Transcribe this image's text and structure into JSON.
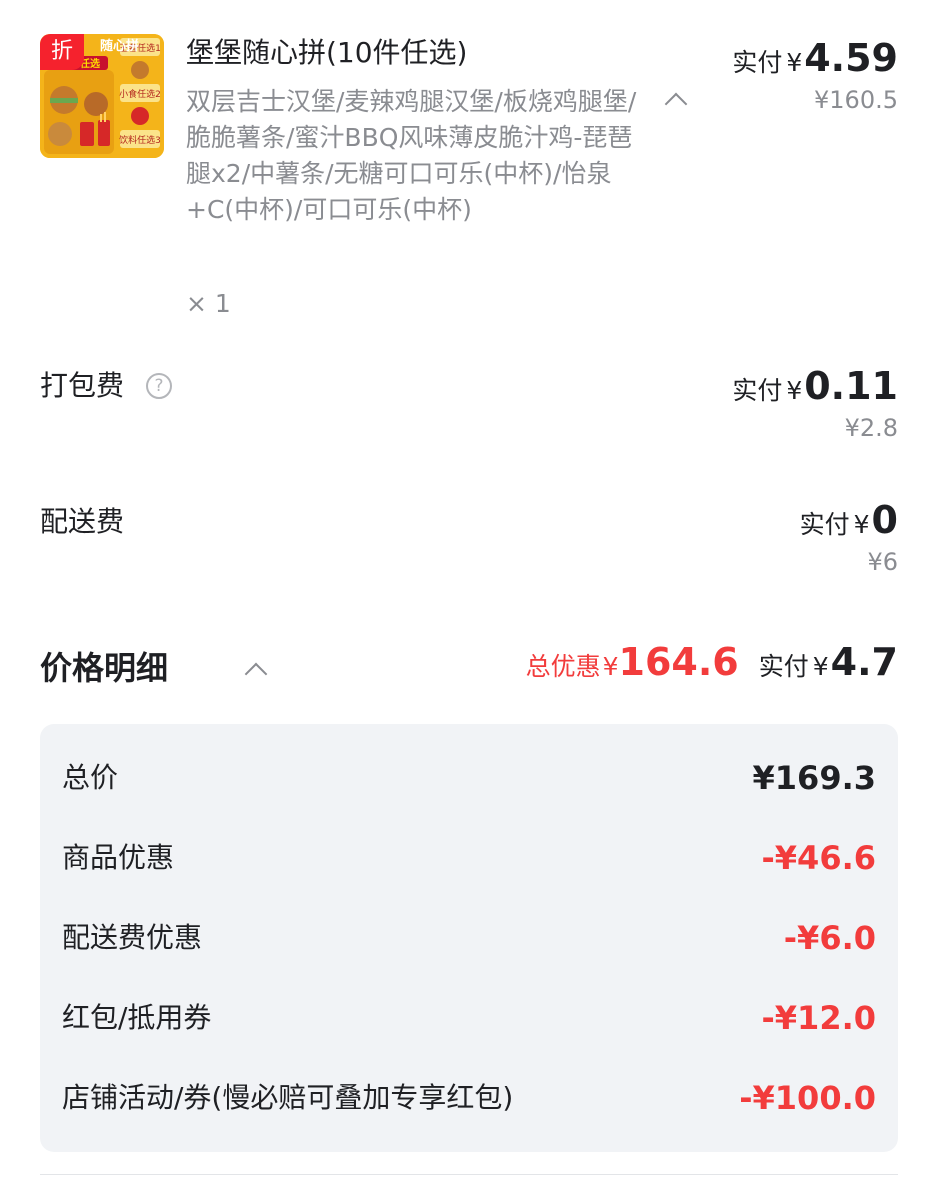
{
  "item": {
    "badge": "折",
    "title": "堡堡随心拼(10件任选)",
    "description": "双层吉士汉堡/麦辣鸡腿汉堡/板烧鸡腿堡/脆脆薯条/蜜汁BBQ风味薄皮脆汁鸡-琵琶 腿x2/中薯条/无糖可口可乐(中杯)/怡泉+C(中杯)/可口可乐(中杯)",
    "quantity": "× 1",
    "paid_label": "实付",
    "currency": "¥",
    "paid_amount": "4.59",
    "original_price": "¥160.5",
    "image_text": [
      "随心拼",
      "10件任选",
      "王者任选1",
      "小食任选2",
      "饮料任选3"
    ]
  },
  "packaging": {
    "label": "打包费",
    "help_icon": "question-circle-icon",
    "paid_label": "实付",
    "currency": "¥",
    "paid_amount": "0.11",
    "original_price": "¥2.8"
  },
  "delivery": {
    "label": "配送费",
    "paid_label": "实付",
    "currency": "¥",
    "paid_amount": "0",
    "original_price": "¥6"
  },
  "price_detail": {
    "title": "价格明细",
    "savings_label": "总优惠",
    "savings_currency": "¥",
    "savings_amount": "164.6",
    "paid_label": "实付",
    "paid_currency": "¥",
    "paid_amount": "4.7",
    "rows": [
      {
        "label": "总价",
        "value": "¥169.3"
      },
      {
        "label": "商品优惠",
        "value": "-¥46.6"
      },
      {
        "label": "配送费优惠",
        "value": "-¥6.0"
      },
      {
        "label": "红包/抵用券",
        "value": "-¥12.0"
      },
      {
        "label": "店铺活动/券(慢必赔可叠加专享红包)",
        "value": "-¥100.0"
      }
    ]
  },
  "colors": {
    "accent_red": "#f23c3c",
    "panel_bg": "#f1f3f6",
    "muted_text": "#8a8c91"
  }
}
